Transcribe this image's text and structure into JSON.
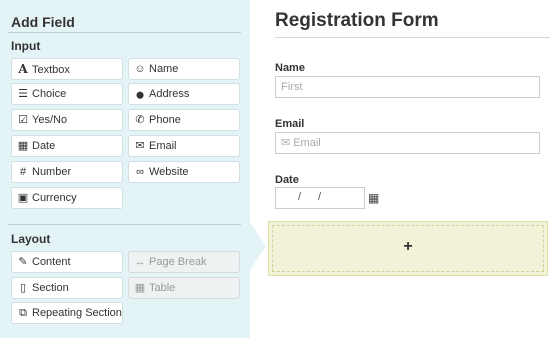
{
  "panel": {
    "title": "Add Field",
    "input_section": "Input",
    "layout_section": "Layout"
  },
  "input_fields": [
    {
      "label": "Textbox",
      "icon": "A"
    },
    {
      "label": "Name",
      "icon": "☺"
    },
    {
      "label": "Choice",
      "icon": "☰"
    },
    {
      "label": "Address",
      "icon": "⬤"
    },
    {
      "label": "Yes/No",
      "icon": "☑"
    },
    {
      "label": "Phone",
      "icon": "✆"
    },
    {
      "label": "Date",
      "icon": "▦"
    },
    {
      "label": "Email",
      "icon": "✉"
    },
    {
      "label": "Number",
      "icon": "#"
    },
    {
      "label": "Website",
      "icon": "∞"
    },
    {
      "label": "Currency",
      "icon": "▣"
    }
  ],
  "layout_fields": [
    {
      "label": "Content",
      "icon": "✎"
    },
    {
      "label": "Page Break",
      "icon": "↔"
    },
    {
      "label": "Section",
      "icon": "▯"
    },
    {
      "label": "Table",
      "icon": "▦"
    },
    {
      "label": "Repeating Section",
      "icon": "⧉"
    }
  ],
  "form": {
    "title": "Registration Form",
    "name_label": "Name",
    "name_placeholder": "First",
    "email_label": "Email",
    "email_placeholder": "Email",
    "email_icon": "✉",
    "date_label": "Date",
    "date_sep1": "/",
    "date_sep2": "/",
    "calendar_icon": "▦",
    "add_symbol": "+"
  }
}
